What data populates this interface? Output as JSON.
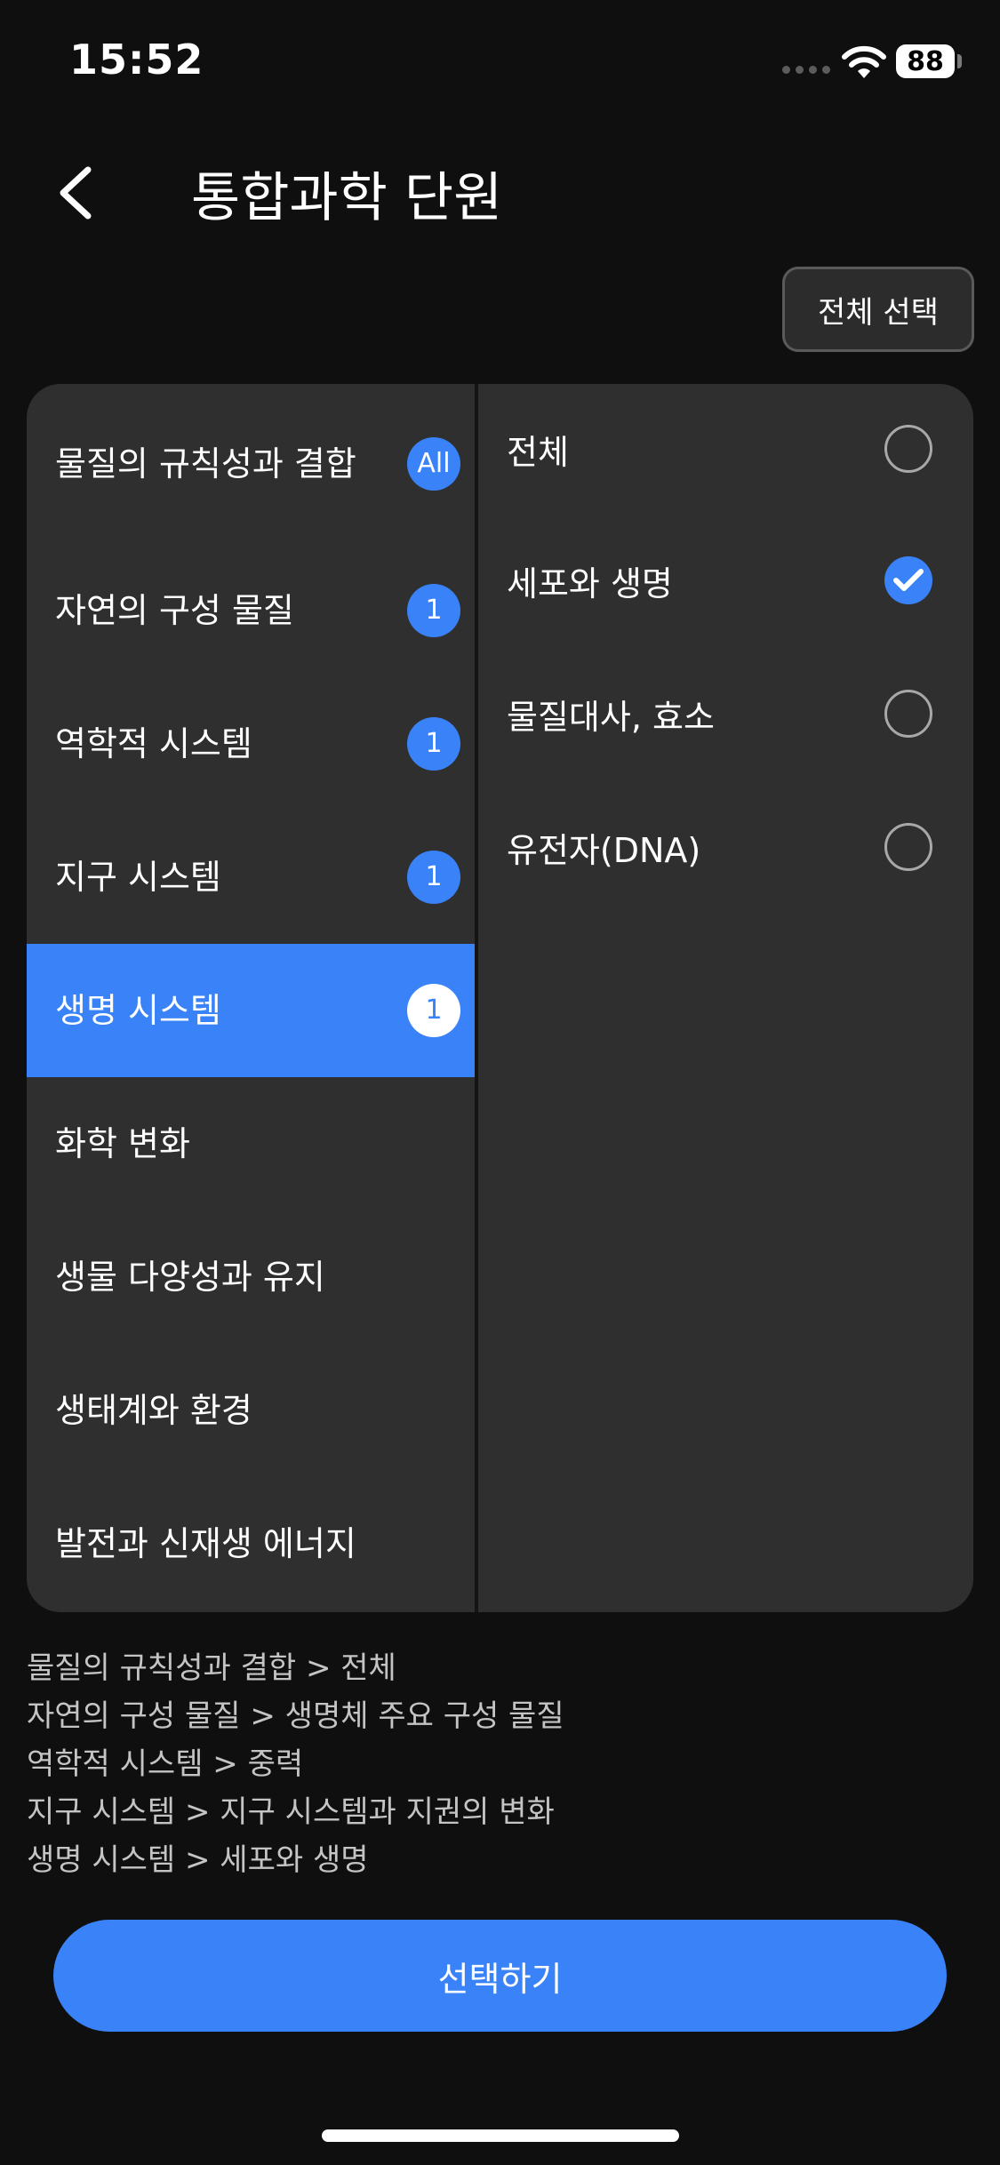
{
  "status_bar": {
    "time": "15:52",
    "battery": "88"
  },
  "header": {
    "title": "통합과학 단원"
  },
  "toolbar": {
    "select_all_label": "전체 선택"
  },
  "left_list": [
    {
      "label": "물질의 규칙성과 결합",
      "badge": "All",
      "active": false
    },
    {
      "label": "자연의 구성 물질",
      "badge": "1",
      "active": false
    },
    {
      "label": "역학적 시스템",
      "badge": "1",
      "active": false
    },
    {
      "label": "지구 시스템",
      "badge": "1",
      "active": false
    },
    {
      "label": "생명 시스템",
      "badge": "1",
      "active": true
    },
    {
      "label": "화학 변화",
      "badge": "",
      "active": false
    },
    {
      "label": "생물 다양성과 유지",
      "badge": "",
      "active": false
    },
    {
      "label": "생태계와 환경",
      "badge": "",
      "active": false
    },
    {
      "label": "발전과 신재생 에너지",
      "badge": "",
      "active": false
    }
  ],
  "right_list": [
    {
      "label": "전체",
      "checked": false
    },
    {
      "label": "세포와 생명",
      "checked": true
    },
    {
      "label": "물질대사, 효소",
      "checked": false
    },
    {
      "label": "유전자(DNA)",
      "checked": false
    }
  ],
  "summary": [
    "물질의 규칙성과 결합 > 전체",
    "자연의 구성 물질 > 생명체 주요 구성 물질",
    "역학적 시스템 > 중력",
    "지구 시스템 > 지구 시스템과 지권의 변화",
    "생명 시스템 > 세포와 생명"
  ],
  "footer": {
    "confirm_label": "선택하기"
  },
  "colors": {
    "accent": "#3a82f7",
    "background": "#0f0f0f",
    "panel": "#2f2f2f"
  }
}
